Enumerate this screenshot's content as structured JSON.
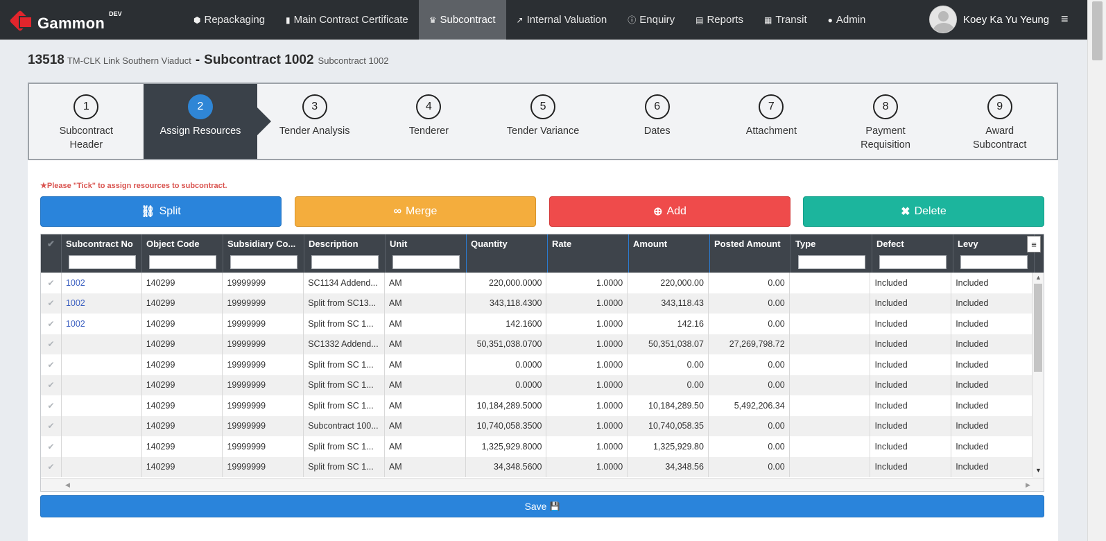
{
  "brand": {
    "name": "Gammon",
    "env": "DEV"
  },
  "nav": [
    {
      "label": "Repackaging",
      "icon": "⬢"
    },
    {
      "label": "Main Contract Certificate",
      "icon": "▮"
    },
    {
      "label": "Subcontract",
      "icon": "♛"
    },
    {
      "label": "Internal Valuation",
      "icon": "↗"
    },
    {
      "label": "Enquiry",
      "icon": "ⓘ"
    },
    {
      "label": "Reports",
      "icon": "▤"
    },
    {
      "label": "Transit",
      "icon": "▦"
    },
    {
      "label": "Admin",
      "icon": "●"
    }
  ],
  "user": {
    "name": "Koey Ka Yu Yeung"
  },
  "menu_icon": "≡",
  "heading": {
    "job_no": "13518",
    "job_name": "TM-CLK Link Southern Viaduct",
    "separator": "-",
    "title": "Subcontract 1002",
    "subtitle": "Subcontract 1002"
  },
  "steps": [
    {
      "num": "1",
      "label": "Subcontract Header"
    },
    {
      "num": "2",
      "label": "Assign Resources"
    },
    {
      "num": "3",
      "label": "Tender Analysis"
    },
    {
      "num": "4",
      "label": "Tenderer"
    },
    {
      "num": "5",
      "label": "Tender Variance"
    },
    {
      "num": "6",
      "label": "Dates"
    },
    {
      "num": "7",
      "label": "Attachment"
    },
    {
      "num": "8",
      "label": "Payment Requisition"
    },
    {
      "num": "9",
      "label": "Award Subcontract"
    }
  ],
  "notice": "★Please \"Tick\" to assign resources to subcontract.",
  "buttons": {
    "split": "Split",
    "merge": "Merge",
    "add": "Add",
    "delete": "Delete",
    "save": "Save"
  },
  "grid": {
    "columns": [
      "Subcontract No",
      "Object Code",
      "Subsidiary Co...",
      "Description",
      "Unit",
      "Quantity",
      "Rate",
      "Amount",
      "Posted Amount",
      "Type",
      "Defect",
      "Levy"
    ],
    "rows": [
      [
        "1002",
        "140299",
        "19999999",
        "SC1134 Addend...",
        "AM",
        "220,000.0000",
        "1.0000",
        "220,000.00",
        "0.00",
        "",
        "Included",
        "Included"
      ],
      [
        "1002",
        "140299",
        "19999999",
        "Split from SC13...",
        "AM",
        "343,118.4300",
        "1.0000",
        "343,118.43",
        "0.00",
        "",
        "Included",
        "Included"
      ],
      [
        "1002",
        "140299",
        "19999999",
        "Split from SC 1...",
        "AM",
        "142.1600",
        "1.0000",
        "142.16",
        "0.00",
        "",
        "Included",
        "Included"
      ],
      [
        "",
        "140299",
        "19999999",
        "SC1332 Addend...",
        "AM",
        "50,351,038.0700",
        "1.0000",
        "50,351,038.07",
        "27,269,798.72",
        "",
        "Included",
        "Included"
      ],
      [
        "",
        "140299",
        "19999999",
        "Split from SC 1...",
        "AM",
        "0.0000",
        "1.0000",
        "0.00",
        "0.00",
        "",
        "Included",
        "Included"
      ],
      [
        "",
        "140299",
        "19999999",
        "Split from SC 1...",
        "AM",
        "0.0000",
        "1.0000",
        "0.00",
        "0.00",
        "",
        "Included",
        "Included"
      ],
      [
        "",
        "140299",
        "19999999",
        "Split from SC 1...",
        "AM",
        "10,184,289.5000",
        "1.0000",
        "10,184,289.50",
        "5,492,206.34",
        "",
        "Included",
        "Included"
      ],
      [
        "",
        "140299",
        "19999999",
        "Subcontract 100...",
        "AM",
        "10,740,058.3500",
        "1.0000",
        "10,740,058.35",
        "0.00",
        "",
        "Included",
        "Included"
      ],
      [
        "",
        "140299",
        "19999999",
        "Split from SC 1...",
        "AM",
        "1,325,929.8000",
        "1.0000",
        "1,325,929.80",
        "0.00",
        "",
        "Included",
        "Included"
      ],
      [
        "",
        "140299",
        "19999999",
        "Split from SC 1...",
        "AM",
        "34,348.5600",
        "1.0000",
        "34,348.56",
        "0.00",
        "",
        "Included",
        "Included"
      ]
    ]
  },
  "colors": {
    "navbar": "#2b2f33",
    "active_step": "#3a4149",
    "step_badge": "#2f86d6",
    "split": "#2a84db",
    "merge": "#f4ad3d",
    "add": "#ef4b4b",
    "delete": "#1cb59d"
  }
}
